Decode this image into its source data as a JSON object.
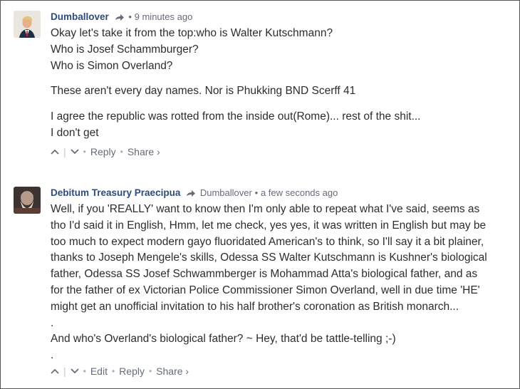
{
  "comments": [
    {
      "author": "Dumballover",
      "reply_to": "",
      "time": "9 minutes ago",
      "lines1": [
        "Okay let's take it from the top:who is Walter Kutschmann?",
        "Who is Josef Schammburger?",
        "Who is Simon Overland?"
      ],
      "lines2": [
        "These aren't every day names. Nor is Phukking BND Scerff 41"
      ],
      "lines3": [
        "I agree the republic was rotted from the inside out(Rome)... rest of the shit...",
        "I don't get"
      ],
      "actions": {
        "reply": "Reply",
        "share": "Share ›"
      }
    },
    {
      "author": "Debitum Treasury Praecipua",
      "reply_to": "Dumballover",
      "time": "a few seconds ago",
      "lines1": [
        "Well, if you 'REALLY' want to know then I'm only able to repeat what I've said, seems as",
        "tho I'd said it in English, Hmm, let me check, yes yes, it was written in English but may be",
        "too much to expect modern gayo fluoridated American's to think, so I'll say it a bit plainer,",
        "thanks to Joseph Mengele's skills, Odessa SS Walter Kutschmann is Kushner's biological",
        "father, Odessa SS Josef Schwammberger is Mohammad Atta's biological father, and as",
        "for the father of ex Victorian Police Commissioner Simon Overland, well in due time 'HE'",
        "might get an unofficial invitation to his half brother's coronation as British monarch...",
        ".",
        "And who's Overland's biological father? ~ Hey, that'd be tattle-telling ;-)",
        "."
      ],
      "actions": {
        "edit": "Edit",
        "reply": "Reply",
        "share": "Share ›"
      }
    }
  ]
}
